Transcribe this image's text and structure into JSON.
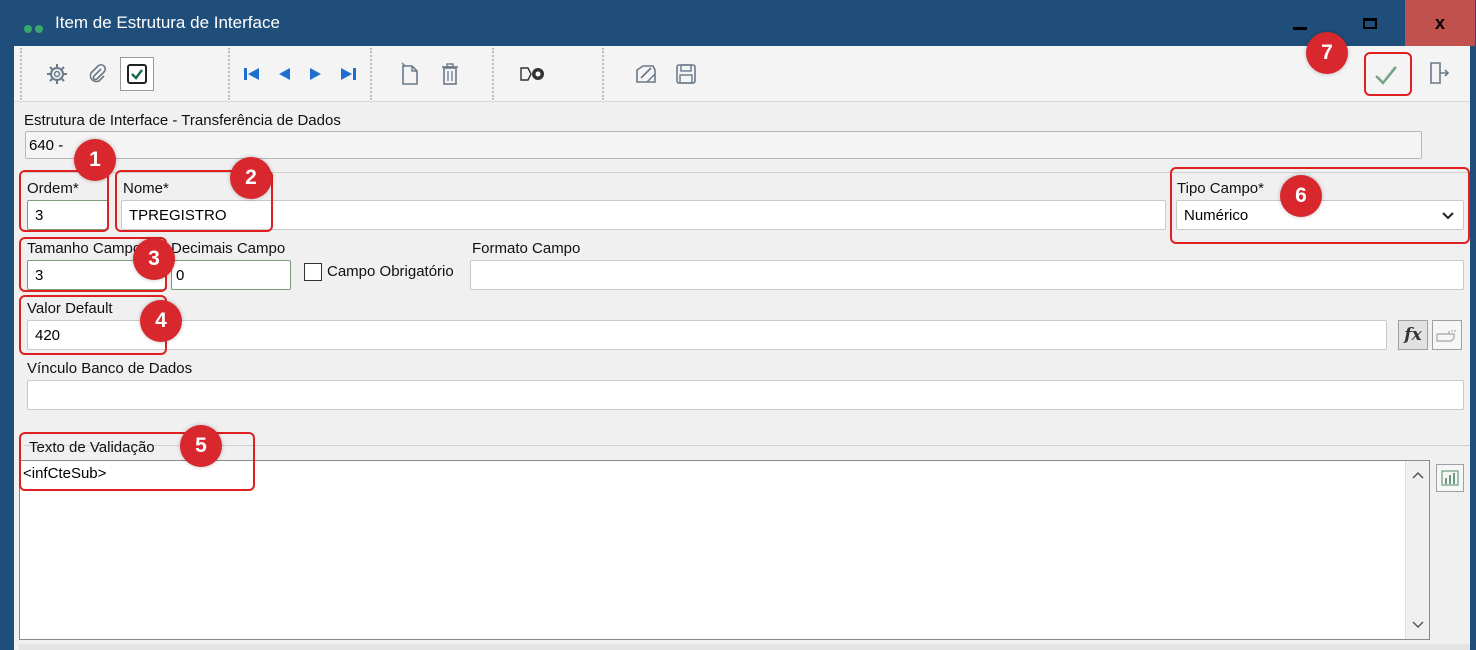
{
  "window": {
    "title": "Item de Estrutura de Interface",
    "minimize_icon": "minimize-icon",
    "maximize_icon": "maximize-icon",
    "close_label": "x"
  },
  "toolbar": {
    "icons": [
      "gear-icon",
      "paperclip-icon",
      "checkbox-icon",
      "first-record-icon",
      "previous-record-icon",
      "next-record-icon",
      "last-record-icon",
      "new-document-icon",
      "trash-icon",
      "search-record-icon",
      "edit-icon",
      "save-icon",
      "confirm-icon",
      "exit-icon"
    ]
  },
  "header": {
    "label": "Estrutura de Interface - Transferência de Dados",
    "value": "640 -"
  },
  "form": {
    "ordem": {
      "label": "Ordem*",
      "value": "3"
    },
    "nome": {
      "label": "Nome*",
      "value": "TPREGISTRO"
    },
    "tipo_campo": {
      "label": "Tipo Campo*",
      "value": "Numérico"
    },
    "tamanho_campo": {
      "label": "Tamanho Campo",
      "value": "3"
    },
    "decimais_campo": {
      "label": "Decimais Campo",
      "value": "0"
    },
    "campo_obrigatorio": {
      "label": "Campo Obrigatório",
      "checked": false
    },
    "formato_campo": {
      "label": "Formato Campo",
      "value": ""
    },
    "valor_default": {
      "label": "Valor Default",
      "value": "420"
    },
    "vinculo_banco": {
      "label": "Vínculo Banco de Dados",
      "value": ""
    },
    "texto_validacao": {
      "label": "Texto de Validação",
      "value": "<infCteSub>"
    }
  },
  "side_buttons": {
    "fx_label": "fx",
    "pointer_icon": "pointer-hand-icon",
    "chart_icon": "chart-icon"
  },
  "annotations": [
    "1",
    "2",
    "3",
    "4",
    "5",
    "6",
    "7"
  ],
  "colors": {
    "titlebar": "#1f4e7a",
    "close_button": "#c0514d",
    "annotation_red": "#d8272d"
  }
}
